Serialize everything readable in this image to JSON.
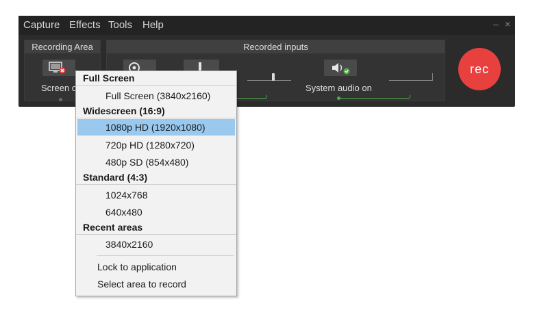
{
  "menubar": {
    "items": [
      "Capture",
      "Effects",
      "Tools",
      "Help"
    ],
    "minimize": "–",
    "close": "×"
  },
  "recording_area": {
    "header": "Recording Area",
    "label": "Screen o"
  },
  "recorded_inputs": {
    "header": "Recorded inputs",
    "system_audio_label": "System audio on"
  },
  "rec_button": {
    "label": "rec"
  },
  "colors": {
    "rec": "#e8403e",
    "selection": "#99c9ef",
    "status_green": "#4fae4a"
  },
  "dropdown": {
    "sections": [
      {
        "header": "Full Screen",
        "items": [
          "Full Screen (3840x2160)"
        ]
      },
      {
        "header": "Widescreen (16:9)",
        "items": [
          "1080p HD (1920x1080)",
          "720p HD (1280x720)",
          "480p SD (854x480)"
        ]
      },
      {
        "header": "Standard (4:3)",
        "items": [
          "1024x768",
          "640x480"
        ]
      },
      {
        "header": "Recent areas",
        "items": [
          "3840x2160"
        ]
      }
    ],
    "selected": "1080p HD (1920x1080)",
    "actions": [
      "Lock to application",
      "Select area to record"
    ]
  }
}
